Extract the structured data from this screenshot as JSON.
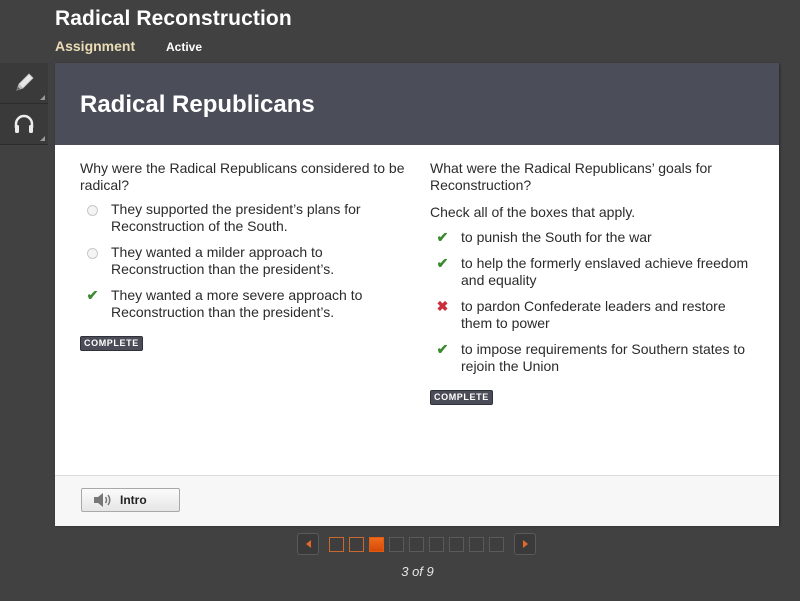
{
  "header": {
    "title": "Radical Reconstruction",
    "type": "Assignment",
    "status": "Active"
  },
  "sidebar": {
    "tools": [
      {
        "name": "pencil-tool",
        "icon": "pencil-icon"
      },
      {
        "name": "audio-tool",
        "icon": "headphones-icon"
      }
    ]
  },
  "panel": {
    "title": "Radical Republicans",
    "questions": [
      {
        "text": "Why were the Radical Republicans considered to be radical?",
        "type": "single-choice",
        "options": [
          {
            "label": "They supported the president’s plans for Reconstruction of the South.",
            "state": "unselected"
          },
          {
            "label": "They wanted a milder approach to Reconstruction than the president’s.",
            "state": "unselected"
          },
          {
            "label": "They wanted a more severe approach to Reconstruction than the president’s.",
            "state": "correct"
          }
        ],
        "badge": "COMPLETE"
      },
      {
        "text": "What were the Radical Republicans’ goals for Reconstruction?",
        "instruction": "Check all of the boxes that apply.",
        "type": "multi-choice",
        "options": [
          {
            "label": "to punish the South for the war",
            "state": "correct"
          },
          {
            "label": "to help the formerly enslaved achieve freedom and equality",
            "state": "correct"
          },
          {
            "label": "to pardon Confederate leaders and restore them to power",
            "state": "incorrect"
          },
          {
            "label": "to impose requirements for Southern states to rejoin the Union",
            "state": "correct"
          }
        ],
        "badge": "COMPLETE"
      }
    ],
    "footer": {
      "intro_button": "Intro"
    }
  },
  "pager": {
    "current": 3,
    "total": 9,
    "label": "3 of 9",
    "pages": [
      "visited",
      "visited",
      "current",
      "unvisited",
      "unvisited",
      "unvisited",
      "unvisited",
      "unvisited",
      "unvisited"
    ]
  },
  "colors": {
    "accent_orange": "#e0692b",
    "correct_green": "#3a8a2e",
    "incorrect_red": "#c9303a",
    "assignment_label": "#e9dcb6"
  }
}
